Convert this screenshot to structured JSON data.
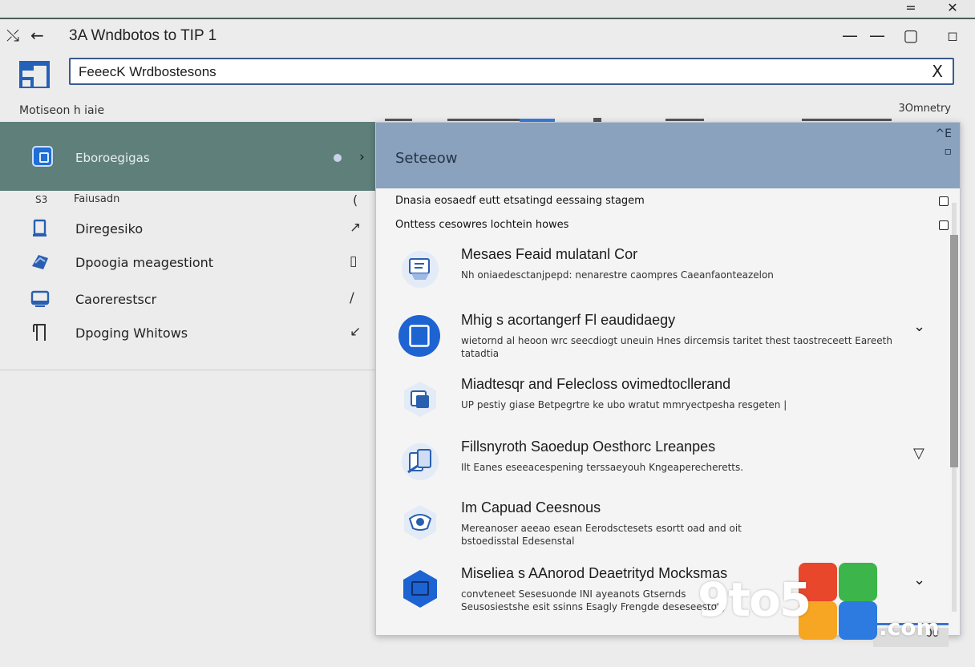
{
  "window": {
    "title": "3A Wndbotos to TIP 1",
    "top_minimize": "=",
    "top_close": "✕"
  },
  "toolbar": {
    "tool_icon": "tools-icon",
    "back_icon": "back-arrow-icon",
    "minimize": "—",
    "maximize": "▢",
    "restore": "▫"
  },
  "search": {
    "value": "FeeecK Wrdbostesons",
    "clear": "X"
  },
  "labels": {
    "section": "Motiseon h iaie",
    "right": "3Omnetry"
  },
  "left_panel": {
    "header_label": "Eboroegigas",
    "sub_num": "S3",
    "sub_title": "Faiusadn",
    "items": [
      {
        "label": "Diregesiko",
        "icon": "device-icon",
        "marker": "↗"
      },
      {
        "label": "Dpoogia meagestiont",
        "icon": "management-icon",
        "marker": "▯"
      },
      {
        "label": "Caorerestscr",
        "icon": "monitor-icon",
        "marker": "/"
      },
      {
        "label": "Dpoging Whitows",
        "icon": "window-icon",
        "marker": "↙"
      }
    ]
  },
  "popup": {
    "title": "Seteeow",
    "header_ctrl_top": "^E",
    "header_ctrl_bottom": "▫",
    "options": [
      {
        "label": "Dnasia eosaedf eutt etsatingd eessaing stagem"
      },
      {
        "label": "Onttess cesowres lochtein howes"
      }
    ],
    "entries": [
      {
        "title": "Mesaes Feaid mulatanl Cor",
        "desc": "Nh oniaedesctanjpepd: nenarestre caompres Caeanfaonteazelon",
        "icon": "feedback-icon",
        "expand": ""
      },
      {
        "title": "Mhig s acortangerf Fl eaudidaegy",
        "desc": "wietornd al heoon wrc seecdiogt uneuin Hnes dircemsis taritet thest taostreceett Eareeth tatadtia",
        "icon": "window-app-icon",
        "expand": "⌄"
      },
      {
        "title": "Miadtesqr and Felecloss ovimedtocllerand",
        "desc": "UP pestiy giase Betpegrtre ke ubo wratut mmryectpesha resgeten |",
        "icon": "sync-icon",
        "expand": ""
      },
      {
        "title": "Fillsnyroth Saoedup Oesthorc Lreanpes",
        "desc": "Ilt Eanes eseeacespening terssaeyouh Kngeaperecheretts.",
        "icon": "files-icon",
        "expand": "▽"
      },
      {
        "title": "Im Capuad Ceesnous",
        "desc": "Mereanoser aeeao esean Eerodsctesets esortt oad and oit bstoedisstal Edesenstal",
        "icon": "capture-icon",
        "expand": ""
      },
      {
        "title": "Miseliea s AAnorod Deaetrityd Mocksmas",
        "desc": "convteneet Sesesuonde INI ayeanots Gtsernds Seusosiestshe esit ssinns Esagly Frengde deseseestgty",
        "icon": "mockups-icon",
        "expand": "⌄"
      }
    ],
    "bottom_button": "00"
  },
  "watermark": {
    "text": "9to5",
    "suffix": ".com",
    "colors": [
      "#e8472c",
      "#f6a623",
      "#3cb54a",
      "#2d7be0"
    ]
  }
}
